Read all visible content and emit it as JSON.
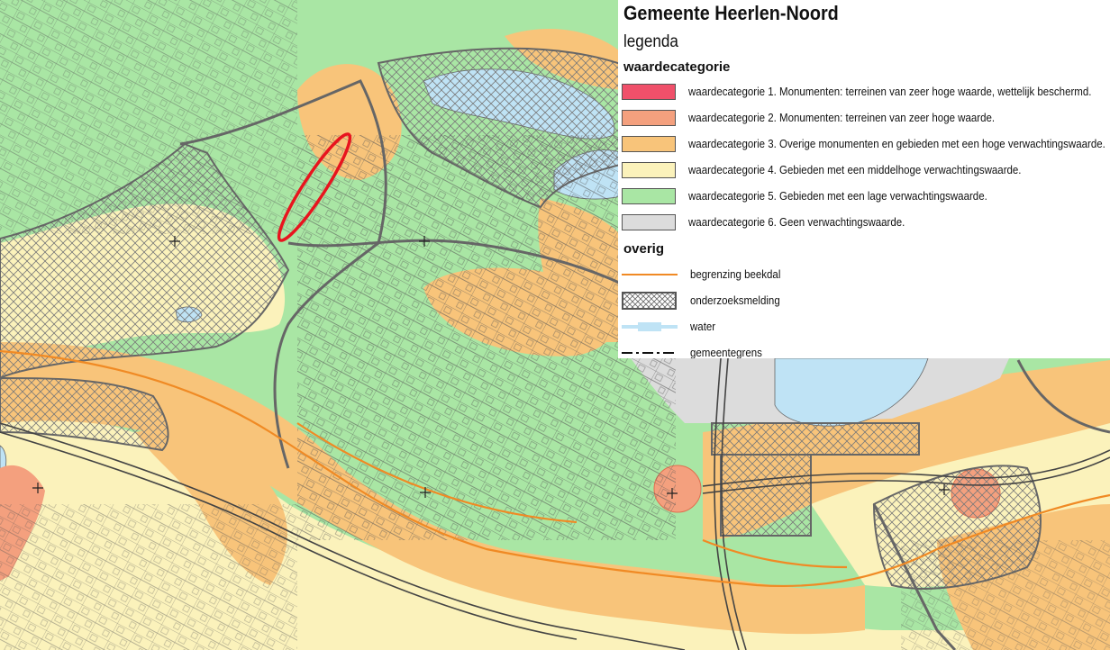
{
  "legend": {
    "title": "Gemeente Heerlen-Noord",
    "subtitle": "legenda",
    "section_waarde": "waardecategorie",
    "section_overig": "overig",
    "categories": [
      {
        "label": "waardecategorie 1. Monumenten: terreinen van zeer hoge waarde, wettelijk beschermd.",
        "color": "#f0506a"
      },
      {
        "label": "waardecategorie 2. Monumenten: terreinen van zeer hoge waarde.",
        "color": "#f4a07e"
      },
      {
        "label": "waardecategorie 3. Overige monumenten en gebieden met een hoge verwachtingswaarde.",
        "color": "#f8c47a"
      },
      {
        "label": "waardecategorie 4. Gebieden met een middelhoge verwachtingswaarde.",
        "color": "#fbf2bb"
      },
      {
        "label": "waardecategorie 5. Gebieden met een lage verwachtingswaarde.",
        "color": "#a9e6a4"
      },
      {
        "label": "waardecategorie 6. Geen verwachtingswaarde.",
        "color": "#dcdcdc"
      }
    ],
    "overig": [
      {
        "label": "begrenzing beekdal",
        "symbol": "orange-line",
        "color": "#f08a24"
      },
      {
        "label": "onderzoeksmelding",
        "symbol": "crosshatch-box",
        "color": "#555555"
      },
      {
        "label": "water",
        "symbol": "water-line",
        "color": "#bfe3f5"
      },
      {
        "label": "gemeentegrens",
        "symbol": "dash-dot-line",
        "color": "#111111"
      }
    ]
  },
  "map": {
    "colors": {
      "cat2": "#f4a07e",
      "cat3": "#f8c47a",
      "cat4": "#fbf2bb",
      "cat5": "#a9e6a4",
      "cat6": "#dcdcdc",
      "water": "#bfe3f5",
      "highlight": "#e8141e",
      "beekdal": "#f08a24"
    }
  }
}
